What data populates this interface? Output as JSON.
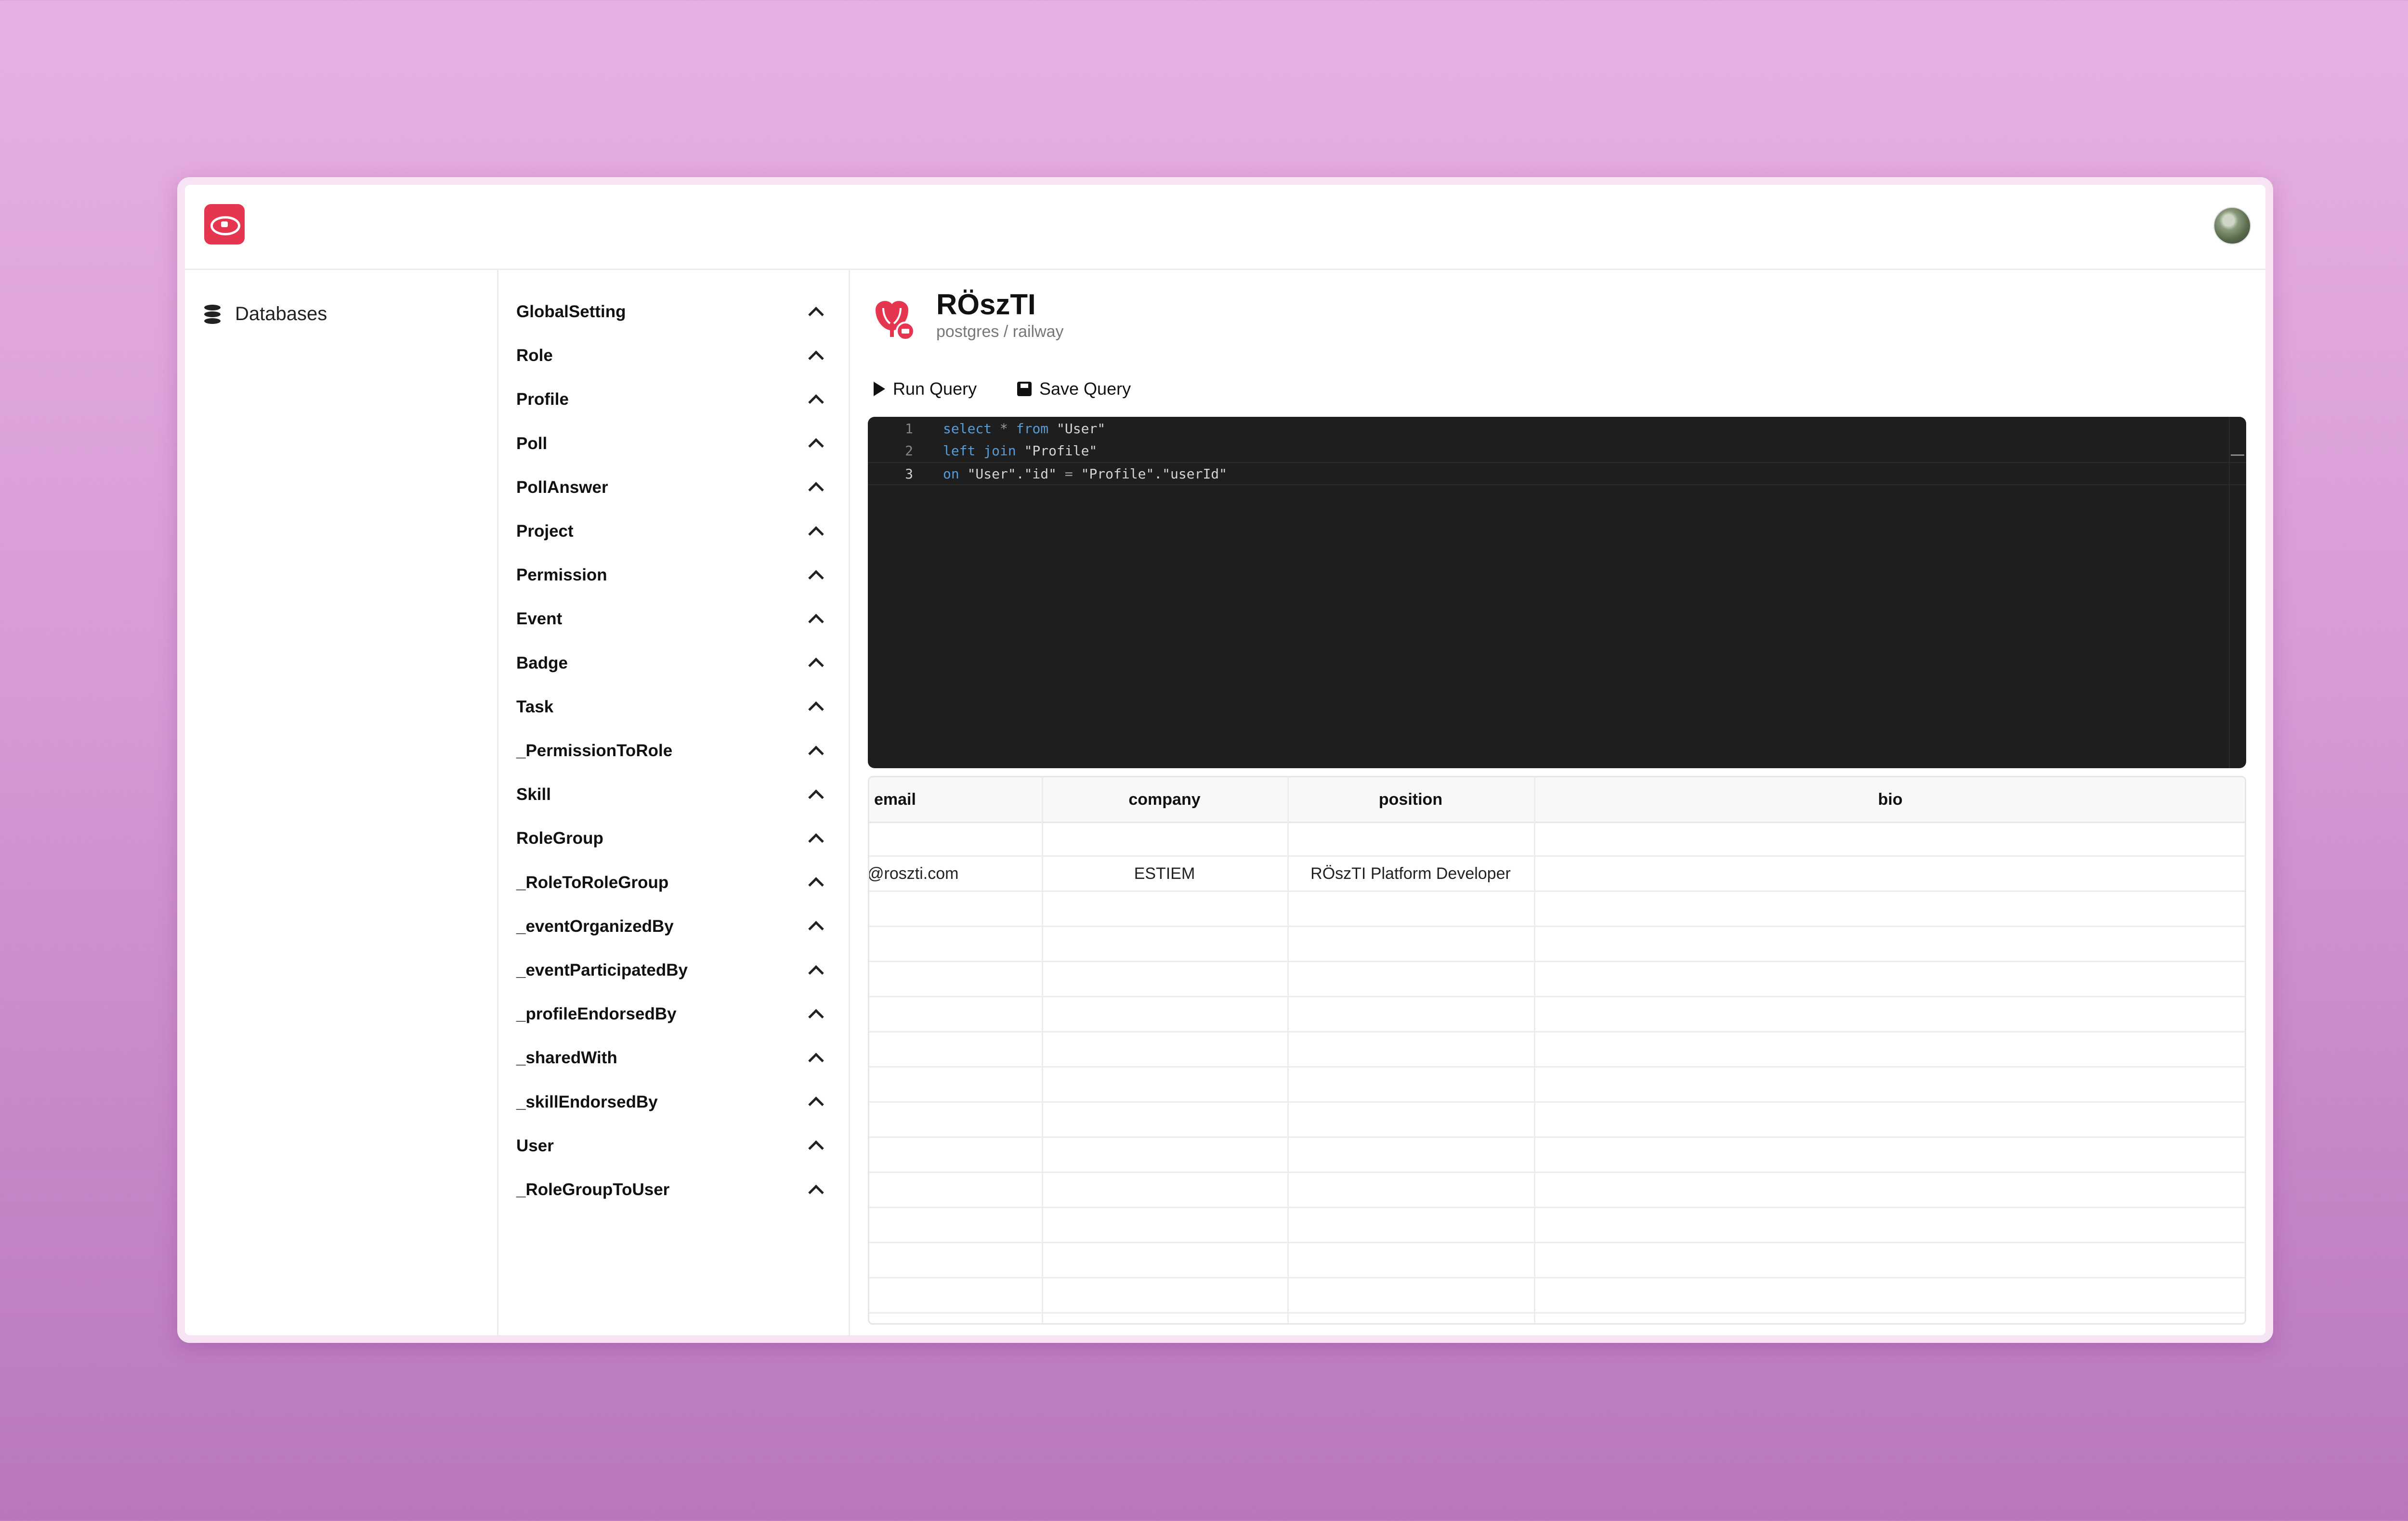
{
  "nav": {
    "databases_label": "Databases"
  },
  "tables": [
    "GlobalSetting",
    "Role",
    "Profile",
    "Poll",
    "PollAnswer",
    "Project",
    "Permission",
    "Event",
    "Badge",
    "Task",
    "_PermissionToRole",
    "Skill",
    "RoleGroup",
    "_RoleToRoleGroup",
    "_eventOrganizedBy",
    "_eventParticipatedBy",
    "_profileEndorsedBy",
    "_sharedWith",
    "_skillEndorsedBy",
    "User",
    "_RoleGroupToUser"
  ],
  "database": {
    "name": "RÖszTI",
    "subtitle": "postgres / railway"
  },
  "toolbar": {
    "run_label": "Run Query",
    "save_label": "Save Query"
  },
  "editor": {
    "lines": [
      {
        "num": "1",
        "tokens": [
          [
            "kw",
            "select"
          ],
          [
            "tx",
            " "
          ],
          [
            "op",
            "*"
          ],
          [
            "tx",
            " "
          ],
          [
            "kw",
            "from"
          ],
          [
            "tx",
            " \"User\""
          ]
        ]
      },
      {
        "num": "2",
        "tokens": [
          [
            "kw",
            "left join"
          ],
          [
            "tx",
            " \"Profile\""
          ]
        ]
      },
      {
        "num": "3",
        "tokens": [
          [
            "kw",
            "on"
          ],
          [
            "tx",
            " \"User\".\"id\" "
          ],
          [
            "op",
            "="
          ],
          [
            "tx",
            " \"Profile\".\"userId\""
          ]
        ]
      }
    ]
  },
  "results": {
    "columns": [
      "email",
      "company",
      "position",
      "bio"
    ],
    "rows": [
      [
        "",
        "",
        "",
        ""
      ],
      [
        "@roszti.com",
        "ESTIEM",
        "RÖszTI Platform Developer",
        ""
      ],
      [
        "",
        "",
        "",
        ""
      ],
      [
        "",
        "",
        "",
        ""
      ],
      [
        "",
        "",
        "",
        ""
      ],
      [
        "",
        "",
        "",
        ""
      ],
      [
        "",
        "",
        "",
        ""
      ],
      [
        "",
        "",
        "",
        ""
      ],
      [
        "",
        "",
        "",
        ""
      ],
      [
        "",
        "",
        "",
        ""
      ],
      [
        "",
        "",
        "",
        ""
      ],
      [
        "",
        "",
        "",
        ""
      ],
      [
        "",
        "",
        "",
        ""
      ],
      [
        "",
        "",
        "",
        ""
      ]
    ]
  },
  "colors": {
    "accent": "#e5354f",
    "editor_bg": "#1e1e1e",
    "keyword": "#569cd6"
  }
}
